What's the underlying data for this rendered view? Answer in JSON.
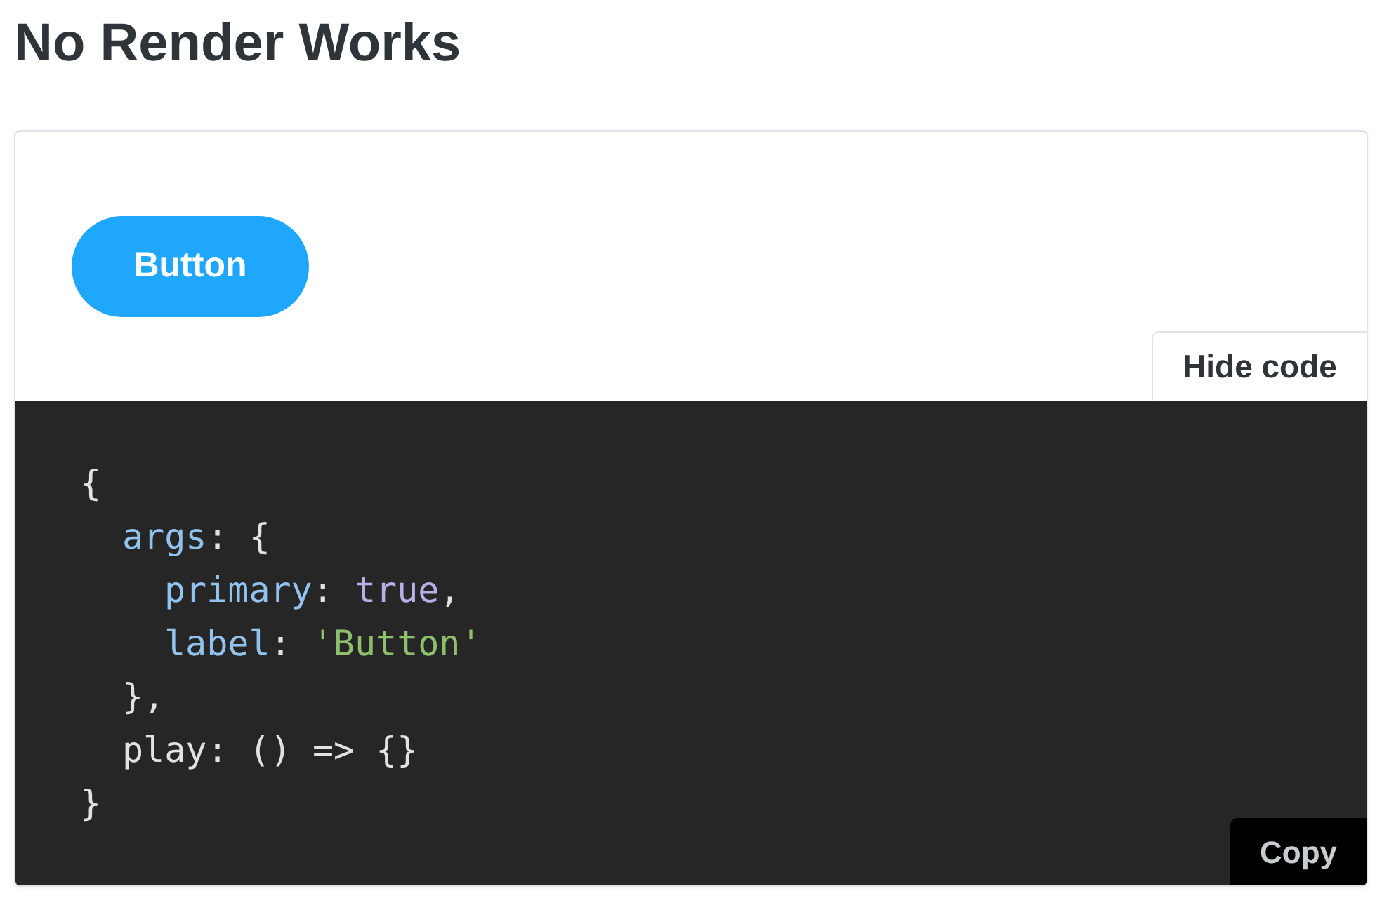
{
  "title": "No Render Works",
  "preview": {
    "button": {
      "label": "Button"
    }
  },
  "code_panel": {
    "toggle_label": "Hide code",
    "lines": [
      {
        "tokens": [
          {
            "kind": "punct",
            "text": "{"
          }
        ],
        "children": [
          {
            "tokens": [
              {
                "kind": "key",
                "text": "args"
              },
              {
                "kind": "punct",
                "text": ": {"
              }
            ],
            "children": [
              {
                "tokens": [
                  {
                    "kind": "key",
                    "text": "primary"
                  },
                  {
                    "kind": "punct",
                    "text": ": "
                  },
                  {
                    "kind": "bool",
                    "text": "true"
                  },
                  {
                    "kind": "punct",
                    "text": ","
                  }
                ]
              },
              {
                "tokens": [
                  {
                    "kind": "key",
                    "text": "label"
                  },
                  {
                    "kind": "punct",
                    "text": ": "
                  },
                  {
                    "kind": "string",
                    "text": "'Button'"
                  }
                ]
              }
            ]
          },
          {
            "tokens": [
              {
                "kind": "punct",
                "text": "},"
              }
            ]
          },
          {
            "tokens": [
              {
                "kind": "plain",
                "text": "play: () => {}"
              }
            ]
          }
        ]
      },
      {
        "tokens": [
          {
            "kind": "punct",
            "text": "}"
          }
        ]
      }
    ],
    "copy_label": "Copy"
  }
}
